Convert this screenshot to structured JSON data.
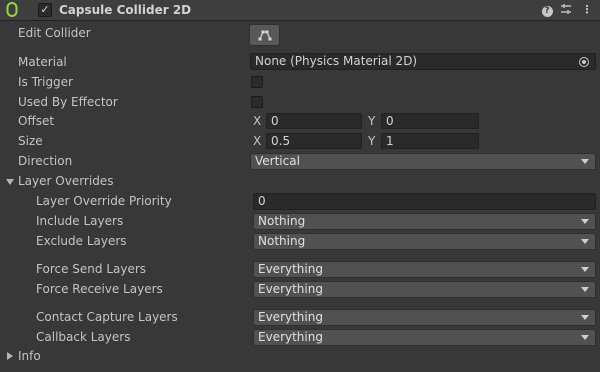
{
  "header": {
    "enabled_checked": true,
    "title": "Capsule Collider 2D",
    "help_icon": "help-icon",
    "presets_icon": "presets-icon",
    "menu_icon": "context-menu-icon",
    "component_icon": "capsule-collider-icon"
  },
  "edit_collider": {
    "label": "Edit Collider",
    "icon": "edit-collider-icon"
  },
  "material": {
    "label": "Material",
    "value": "None (Physics Material 2D)"
  },
  "is_trigger": {
    "label": "Is Trigger",
    "checked": false
  },
  "used_by_effector": {
    "label": "Used By Effector",
    "checked": false
  },
  "offset": {
    "label": "Offset",
    "x_label": "X",
    "x": "0",
    "y_label": "Y",
    "y": "0"
  },
  "size": {
    "label": "Size",
    "x_label": "X",
    "x": "0.5",
    "y_label": "Y",
    "y": "1"
  },
  "direction": {
    "label": "Direction",
    "value": "Vertical"
  },
  "layer_overrides": {
    "label": "Layer Overrides",
    "expanded": true,
    "priority": {
      "label": "Layer Override Priority",
      "value": "0"
    },
    "include": {
      "label": "Include Layers",
      "value": "Nothing"
    },
    "exclude": {
      "label": "Exclude Layers",
      "value": "Nothing"
    },
    "force_send": {
      "label": "Force Send Layers",
      "value": "Everything"
    },
    "force_receive": {
      "label": "Force Receive Layers",
      "value": "Everything"
    },
    "contact_capture": {
      "label": "Contact Capture Layers",
      "value": "Everything"
    },
    "callback": {
      "label": "Callback Layers",
      "value": "Everything"
    }
  },
  "info": {
    "label": "Info",
    "expanded": false
  },
  "colors": {
    "accent_green": "#93d64a",
    "panel_bg": "#383838",
    "field_bg": "#2a2a2a"
  }
}
